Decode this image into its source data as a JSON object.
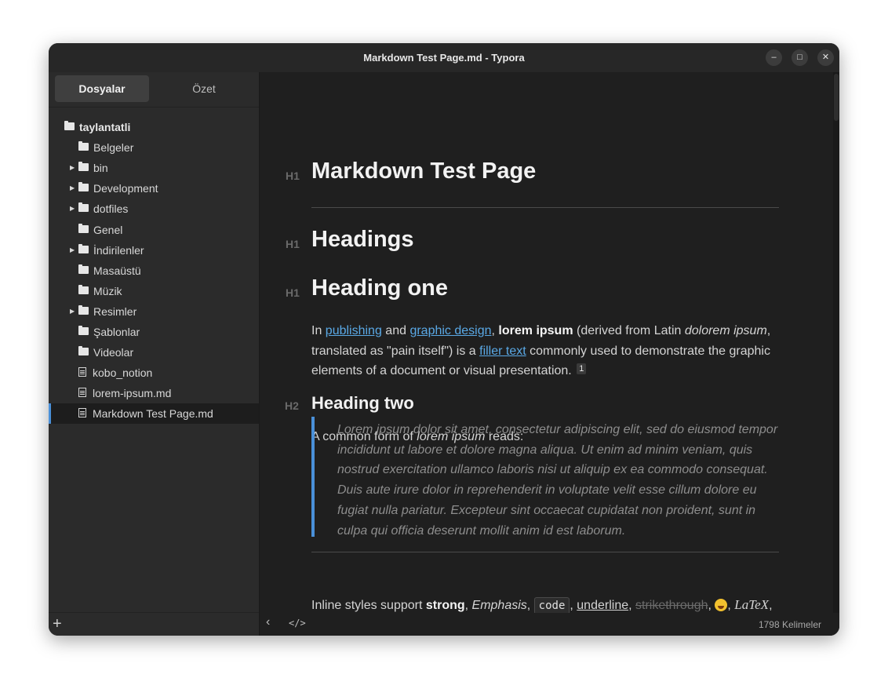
{
  "window": {
    "title": "Markdown Test Page.md - Typora"
  },
  "controls": {
    "minimize": "–",
    "maximize": "□",
    "close": "✕"
  },
  "sidebar": {
    "tabs": [
      "Dosyalar",
      "Özet"
    ],
    "tree": [
      {
        "label": "taylantatli",
        "type": "folder",
        "expandable": false,
        "root": true
      },
      {
        "label": "Belgeler",
        "type": "folder",
        "expandable": false
      },
      {
        "label": "bin",
        "type": "folder",
        "expandable": true
      },
      {
        "label": "Development",
        "type": "folder",
        "expandable": true
      },
      {
        "label": "dotfiles",
        "type": "folder",
        "expandable": true
      },
      {
        "label": "Genel",
        "type": "folder",
        "expandable": false
      },
      {
        "label": "İndirilenler",
        "type": "folder",
        "expandable": true
      },
      {
        "label": "Masaüstü",
        "type": "folder",
        "expandable": false
      },
      {
        "label": "Müzik",
        "type": "folder",
        "expandable": false
      },
      {
        "label": "Resimler",
        "type": "folder",
        "expandable": true
      },
      {
        "label": "Şablonlar",
        "type": "folder",
        "expandable": false
      },
      {
        "label": "Videolar",
        "type": "folder",
        "expandable": false
      },
      {
        "label": "kobo_notion",
        "type": "file",
        "expandable": false
      },
      {
        "label": "lorem-ipsum.md",
        "type": "file",
        "expandable": false
      },
      {
        "label": "Markdown Test Page.md",
        "type": "file",
        "expandable": false,
        "selected": true
      }
    ],
    "add_label": "+"
  },
  "editor": {
    "marks": {
      "h1": "H1",
      "h2": "H2"
    },
    "title": "Markdown Test Page",
    "headings_title": "Headings",
    "heading_one": "Heading one",
    "para1": {
      "t1": "In ",
      "link1": "publishing",
      "t2": " and ",
      "link2": "graphic design",
      "t3": ", ",
      "bold": "lorem ipsum",
      "t4": " (derived from Latin ",
      "italic": "dolorem ipsum",
      "t5": ", translated as \"pain itself\") is a ",
      "link3": "filler text",
      "t6": " commonly used to demonstrate the graphic elements of a document or visual presentation.",
      "footnote": "1"
    },
    "heading_two": "Heading two",
    "para2": {
      "t1": "A common form of ",
      "italic": "lorem ipsum",
      "t2": " reads:"
    },
    "quote": "Lorem ipsum dolor sit amet, consectetur adipiscing elit, sed do eiusmod tempor incididunt ut labore et dolore magna aliqua. Ut enim ad minim veniam, quis nostrud exercitation ullamco laboris nisi ut aliquip ex ea commodo consequat. Duis aute irure dolor in reprehenderit in voluptate velit esse cillum dolore eu fugiat nulla pariatur. Excepteur sint occaecat cupidatat non proident, sunt in culpa qui officia deserunt mollit anim id est laborum.",
    "inline": {
      "prefix": "Inline styles support ",
      "strong": "strong",
      "sep1": ", ",
      "emphasis": "Emphasis",
      "sep2": ", ",
      "code": "code",
      "sep3": ", ",
      "underline": "underline",
      "sep4": ", ",
      "strike": "strikethrough",
      "sep5": ", ",
      "sep6": ", ",
      "latex": "LaTeX",
      "sep7": ","
    }
  },
  "status": {
    "back": "‹",
    "source": "</>",
    "word_count": "1798 Kelimeler"
  },
  "colors": {
    "accent": "#4a90d9",
    "link": "#5aa9e6",
    "background": "#1f1f1f",
    "sidebar": "#2b2b2b"
  }
}
